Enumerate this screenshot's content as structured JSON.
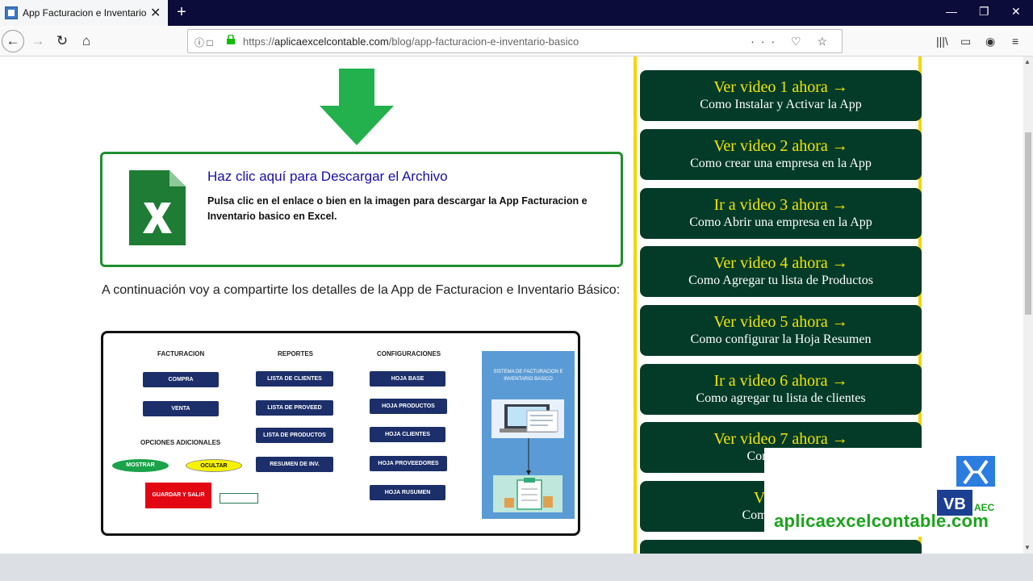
{
  "browser": {
    "tab_title": "App Facturacion e Inventario b",
    "new_tab_glyph": "+",
    "url_prefix": "https://",
    "url_domain": "aplicaexcelcontable.com",
    "url_path": "/blog/app-facturacion-e-inventario-basico"
  },
  "download": {
    "title": "Haz clic aquí para Descargar el Archivo",
    "description": "Pulsa clic en el enlace o bien en la imagen para descargar la App Facturacion e Inventario basico en Excel."
  },
  "intro_text": "A continuación voy a compartirte los detalles de la App de Facturacion e Inventario Básico:",
  "diagram": {
    "col_facturacion": "FACTURACION",
    "col_reportes": "REPORTES",
    "col_configuraciones": "CONFIGURACIONES",
    "btn_compra": "COMPRA",
    "btn_venta": "VENTA",
    "opciones": "OPCIONES ADICIONALES",
    "btn_mostrar": "MOSTRAR",
    "btn_ocultar": "OCULTAR",
    "btn_guardar": "GUARDAR Y SALIR",
    "rep1": "LISTA DE CLIENTES",
    "rep2": "LISTA DE PROVEED",
    "rep3": "LISTA DE PRODUCTOS",
    "rep4": "RESUMEN DE INV.",
    "cfg1": "HOJA BASE",
    "cfg2": "HOJA PRODUCTOS",
    "cfg3": "HOJA CLIENTES",
    "cfg4": "HOJA PROVEEDORES",
    "cfg5": "HOJA  RUSUMEN",
    "panel_title": "SISTEMA DE FACTURACION E INVENTARIO BASICO"
  },
  "videos": [
    {
      "title": "Ver video 1 ahora →",
      "subtitle": "Como Instalar y Activar la App"
    },
    {
      "title": "Ver video 2 ahora →",
      "subtitle": "Como crear una empresa en la App"
    },
    {
      "title": "Ir a video 3 ahora →",
      "subtitle": "Como Abrir una empresa en la App"
    },
    {
      "title": "Ver video 4 ahora →",
      "subtitle": "Como Agregar tu lista de Productos"
    },
    {
      "title": "Ver video 5 ahora →",
      "subtitle": "Como configurar la Hoja Resumen"
    },
    {
      "title": "Ir a video 6 ahora →",
      "subtitle": "Como agregar tu lista de clientes"
    },
    {
      "title": "Ver video 7 ahora →",
      "subtitle": "Como config"
    },
    {
      "title": "Ver vide",
      "subtitle": "Como grabar u"
    }
  ],
  "watermark": {
    "text": "aplicaexcelcontable.com",
    "logo_vb": "VB",
    "logo_aec": "AEC"
  },
  "colors": {
    "accent_green": "#1f8f2f",
    "video_button_bg": "#033b28",
    "video_title": "#f2e600",
    "sidebar_border": "#f2d600"
  }
}
